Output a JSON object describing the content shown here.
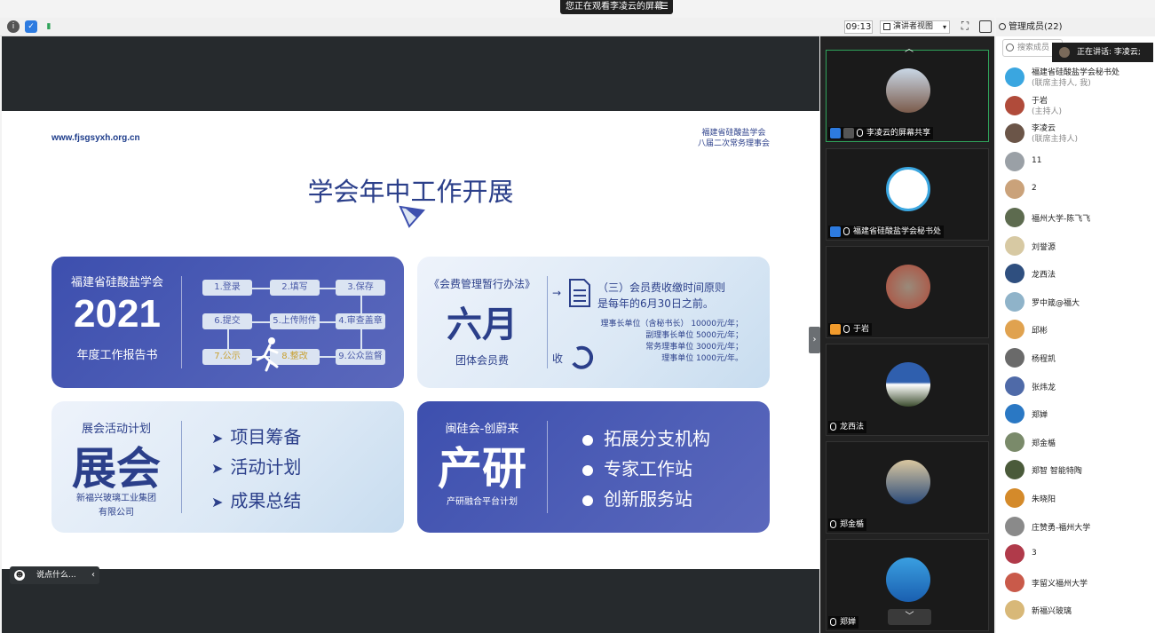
{
  "banner": {
    "text": "您正在观看李凌云的屏幕"
  },
  "toolbar": {
    "clock": "09:13",
    "view_mode": "演讲者视图"
  },
  "participants_header": {
    "label": "管理成员(22)"
  },
  "slide": {
    "url": "www.fjsgsyxh.org.cn",
    "org_line1": "福建省硅酸盐学会",
    "org_line2": "八届二次常务理事会",
    "title": "学会年中工作开展",
    "card1": {
      "org": "福建省硅酸盐学会",
      "year": "2021",
      "sub": "年度工作报告书",
      "steps": [
        "1.登录",
        "2.填写",
        "3.保存",
        "6.提交",
        "5.上传附件",
        "4.审查盖章",
        "7.公示",
        "8.整改",
        "9.公众监督"
      ]
    },
    "card2": {
      "doc": "《会费管理暂行办法》",
      "big": "六月",
      "sub": "团体会员费",
      "rule_line1": "（三）会员费收缴时间原则",
      "rule_line2": "是每年的6月30日之前。",
      "fees": [
        "理事长单位（含秘书长） 10000元/年；",
        "副理事长单位 5000元/年；",
        "常务理事单位 3000元/年；",
        "理事单位 1000元/年。"
      ],
      "collect": "收"
    },
    "card3": {
      "label": "展会活动计划",
      "big": "展会",
      "company_line1": "新福兴玻璃工业集团",
      "company_line2": "有限公司",
      "bullets": [
        "项目筹备",
        "活动计划",
        "成果总结"
      ]
    },
    "card4": {
      "label": "闽硅会-创蔚来",
      "big": "产研",
      "sub": "产研融合平台计划",
      "bullets": [
        "拓展分支机构",
        "专家工作站",
        "创新服务站"
      ]
    }
  },
  "chat": {
    "placeholder": "说点什么..."
  },
  "gallery": {
    "tiles": [
      {
        "name": "李凌云的屏幕共享"
      },
      {
        "name": "福建省硅酸盐学会秘书处"
      },
      {
        "name": "于岩"
      },
      {
        "name": "龙西法"
      },
      {
        "name": "郑金楯"
      },
      {
        "name": "郑婵"
      }
    ]
  },
  "participants": {
    "search_placeholder": "搜索成员",
    "speaking": "正在讲话: 李凌云;",
    "list": [
      {
        "name": "福建省硅酸盐学会秘书处",
        "role": "(联席主持人, 我)",
        "color": "#3aa6e0"
      },
      {
        "name": "于岩",
        "role": "(主持人)",
        "color": "#b04b3a"
      },
      {
        "name": "李凌云",
        "role": "(联席主持人)",
        "color": "#6b5548"
      },
      {
        "name": "11",
        "role": "",
        "color": "#9aa0a6"
      },
      {
        "name": "2",
        "role": "",
        "color": "#caa27a"
      },
      {
        "name": "福州大学-陈飞飞",
        "role": "",
        "color": "#5d6b4f"
      },
      {
        "name": "刘誉源",
        "role": "",
        "color": "#d7c9a3"
      },
      {
        "name": "龙西法",
        "role": "",
        "color": "#2f4f7f"
      },
      {
        "name": "罗中箴@福大",
        "role": "",
        "color": "#8fb3c9"
      },
      {
        "name": "邱彬",
        "role": "",
        "color": "#e0a24f"
      },
      {
        "name": "杨程凯",
        "role": "",
        "color": "#6a6a6a"
      },
      {
        "name": "张炜龙",
        "role": "",
        "color": "#4f6aa8"
      },
      {
        "name": "郑婵",
        "role": "",
        "color": "#2a78c4"
      },
      {
        "name": "郑金楯",
        "role": "",
        "color": "#7a8a6a"
      },
      {
        "name": "郑智 智能特陶",
        "role": "",
        "color": "#4a5a3a"
      },
      {
        "name": "朱晓阳",
        "role": "",
        "color": "#d48a2a"
      },
      {
        "name": "庄赞勇-福州大学",
        "role": "",
        "color": "#8a8a8a"
      },
      {
        "name": "3",
        "role": "",
        "color": "#b03a4a"
      },
      {
        "name": "李留义福州大学",
        "role": "",
        "color": "#c95a4a"
      },
      {
        "name": "新福兴玻璃",
        "role": "",
        "color": "#d8b878"
      }
    ]
  },
  "colors": {
    "accent": "#2b3f8a",
    "dark_card": "#4a5ab3",
    "active_tile": "#2fa35a"
  }
}
